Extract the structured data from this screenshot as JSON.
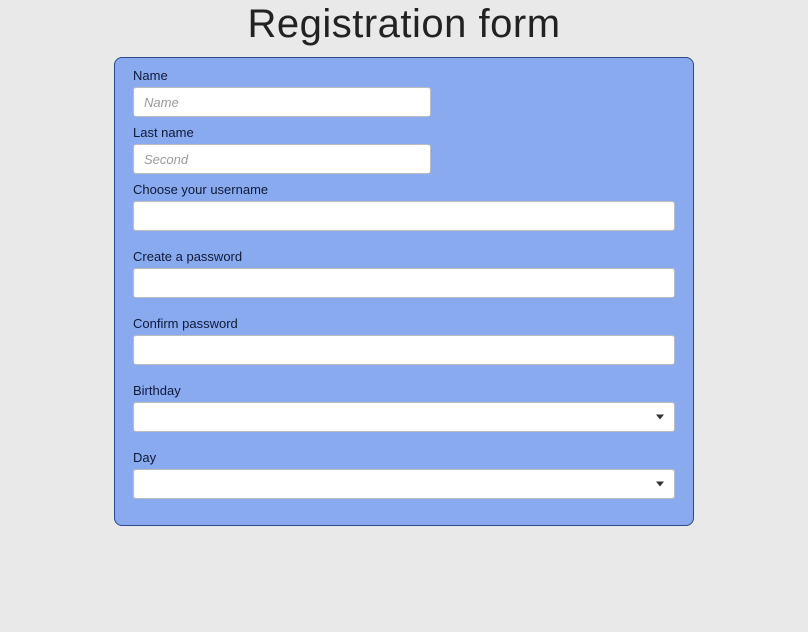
{
  "title": "Registration form",
  "fields": {
    "name": {
      "label": "Name",
      "placeholder": "Name"
    },
    "lastname": {
      "label": "Last name",
      "placeholder": "Second"
    },
    "username": {
      "label": "Choose your username",
      "placeholder": ""
    },
    "password": {
      "label": "Create a password",
      "placeholder": ""
    },
    "confirm": {
      "label": "Confirm password",
      "placeholder": ""
    },
    "birthday": {
      "label": "Birthday"
    },
    "day": {
      "label": "Day"
    }
  }
}
